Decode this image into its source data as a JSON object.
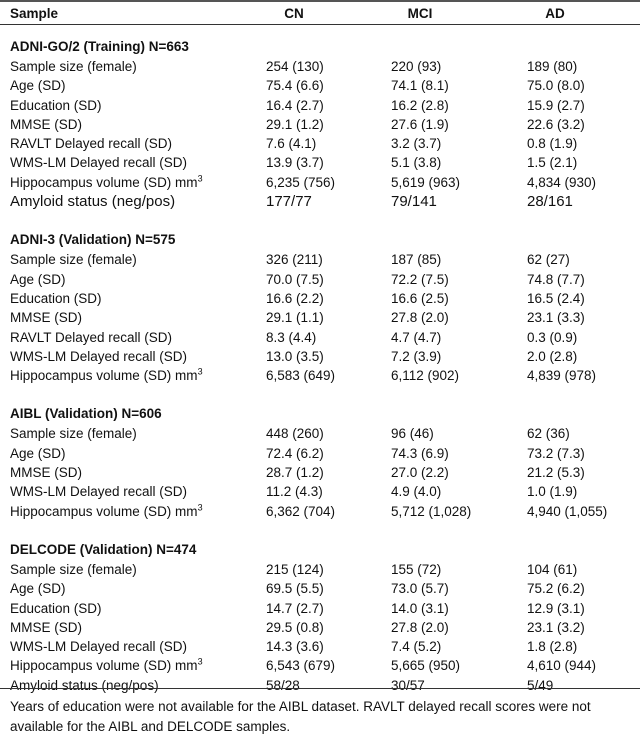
{
  "columns": [
    "Sample",
    "CN",
    "MCI",
    "AD"
  ],
  "sections": [
    {
      "title": "ADNI-GO/2 (Training) N=663",
      "rows": [
        {
          "label": "Sample size (female)",
          "cn": "254 (130)",
          "mci": "220 (93)",
          "ad": "189 (80)"
        },
        {
          "label": "Age (SD)",
          "cn": "75.4 (6.6)",
          "mci": "74.1 (8.1)",
          "ad": "75.0 (8.0)"
        },
        {
          "label": "Education (SD)",
          "cn": "16.4 (2.7)",
          "mci": "16.2 (2.8)",
          "ad": "15.9 (2.7)"
        },
        {
          "label": "MMSE (SD)",
          "cn": "29.1 (1.2)",
          "mci": "27.6 (1.9)",
          "ad": "22.6 (3.2)"
        },
        {
          "label": "RAVLT Delayed recall (SD)",
          "cn": "7.6 (4.1)",
          "mci": "3.2 (3.7)",
          "ad": "0.8 (1.9)"
        },
        {
          "label": "WMS-LM Delayed recall (SD)",
          "cn": "13.9 (3.7)",
          "mci": "5.1 (3.8)",
          "ad": "1.5 (2.1)"
        },
        {
          "label": "Hippocampus volume (SD) mm",
          "sup": "3",
          "cn": "6,235 (756)",
          "mci": "5,619 (963)",
          "ad": "4,834 (930)"
        },
        {
          "label": "Amyloid status (neg/pos)",
          "cn": "177/77",
          "mci": "79/141",
          "ad": "28/161",
          "big": true
        }
      ]
    },
    {
      "title": "ADNI-3 (Validation) N=575",
      "rows": [
        {
          "label": "Sample size (female)",
          "cn": "326 (211)",
          "mci": "187 (85)",
          "ad": "62 (27)"
        },
        {
          "label": "Age (SD)",
          "cn": "70.0 (7.5)",
          "mci": "72.2 (7.5)",
          "ad": "74.8 (7.7)"
        },
        {
          "label": "Education (SD)",
          "cn": "16.6 (2.2)",
          "mci": "16.6 (2.5)",
          "ad": "16.5 (2.4)"
        },
        {
          "label": "MMSE (SD)",
          "cn": "29.1 (1.1)",
          "mci": "27.8 (2.0)",
          "ad": "23.1 (3.3)"
        },
        {
          "label": "RAVLT Delayed recall (SD)",
          "cn": "8.3 (4.4)",
          "mci": "4.7 (4.7)",
          "ad": "0.3 (0.9)"
        },
        {
          "label": "WMS-LM Delayed recall (SD)",
          "cn": "13.0 (3.5)",
          "mci": "7.2 (3.9)",
          "ad": "2.0 (2.8)"
        },
        {
          "label": "Hippocampus volume (SD) mm",
          "sup": "3",
          "cn": "6,583 (649)",
          "mci": "6,112 (902)",
          "ad": "4,839 (978)"
        }
      ]
    },
    {
      "title": "AIBL (Validation) N=606",
      "rows": [
        {
          "label": "Sample size (female)",
          "cn": "448 (260)",
          "mci": "96 (46)",
          "ad": "62 (36)"
        },
        {
          "label": "Age (SD)",
          "cn": "72.4 (6.2)",
          "mci": "74.3 (6.9)",
          "ad": "73.2 (7.3)"
        },
        {
          "label": "MMSE (SD)",
          "cn": "28.7 (1.2)",
          "mci": "27.0 (2.2)",
          "ad": "21.2 (5.3)"
        },
        {
          "label": "WMS-LM Delayed recall (SD)",
          "cn": "11.2 (4.3)",
          "mci": "4.9 (4.0)",
          "ad": "1.0 (1.9)"
        },
        {
          "label": "Hippocampus volume (SD) mm",
          "sup": "3",
          "cn": "6,362 (704)",
          "mci": "5,712 (1,028)",
          "ad": "4,940 (1,055)"
        }
      ]
    },
    {
      "title": "DELCODE (Validation) N=474",
      "rows": [
        {
          "label": "Sample size (female)",
          "cn": "215 (124)",
          "mci": "155 (72)",
          "ad": "104 (61)"
        },
        {
          "label": "Age (SD)",
          "cn": "69.5 (5.5)",
          "mci": "73.0 (5.7)",
          "ad": "75.2 (6.2)"
        },
        {
          "label": "Education (SD)",
          "cn": "14.7 (2.7)",
          "mci": "14.0 (3.1)",
          "ad": "12.9 (3.1)"
        },
        {
          "label": "MMSE (SD)",
          "cn": "29.5 (0.8)",
          "mci": "27.8 (2.0)",
          "ad": "23.1 (3.2)"
        },
        {
          "label": "WMS-LM Delayed recall (SD)",
          "cn": "14.3 (3.6)",
          "mci": "7.4 (5.2)",
          "ad": "1.8 (2.8)"
        },
        {
          "label": "Hippocampus volume (SD) mm",
          "sup": "3",
          "cn": "6,543 (679)",
          "mci": "5,665 (950)",
          "ad": "4,610 (944)"
        },
        {
          "label": "Amyloid status (neg/pos)",
          "cn": "58/28",
          "mci": "30/57",
          "ad": "5/49"
        }
      ]
    }
  ],
  "footnote": "Years of education were not available for the AIBL dataset. RAVLT delayed recall scores were not available for the AIBL and DELCODE samples."
}
